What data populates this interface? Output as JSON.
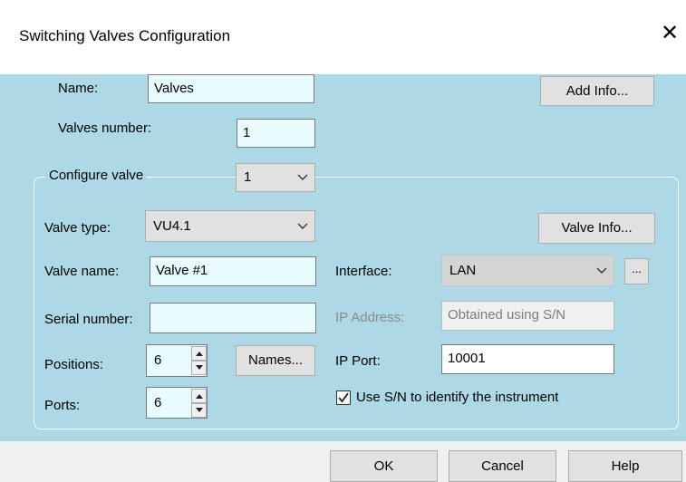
{
  "window": {
    "title": "Switching Valves Configuration",
    "close_symbol": "✕"
  },
  "fields": {
    "name_label": "Name:",
    "name_value": "Valves",
    "valves_number_label": "Valves number:",
    "valves_number_value": "1",
    "add_info_label": "Add Info..."
  },
  "configure": {
    "legend": "Configure valve",
    "selected_valve": "1",
    "valve_type_label": "Valve type:",
    "valve_type_value": "VU4.1",
    "valve_info_label": "Valve Info...",
    "valve_name_label": "Valve name:",
    "valve_name_value": "Valve #1",
    "serial_label": "Serial number:",
    "serial_value": "",
    "positions_label": "Positions:",
    "positions_value": "6",
    "names_button_label": "Names...",
    "ports_label": "Ports:",
    "ports_value": "6",
    "interface_label": "Interface:",
    "interface_value": "LAN",
    "ellipsis_label": "...",
    "ip_address_label": "IP Address:",
    "ip_address_value": "Obtained using S/N",
    "ip_port_label": "IP Port:",
    "ip_port_value": "10001",
    "use_sn_checked": true,
    "use_sn_label": "Use S/N to identify the instrument"
  },
  "footer": {
    "ok_label": "OK",
    "cancel_label": "Cancel",
    "help_label": "Help"
  }
}
